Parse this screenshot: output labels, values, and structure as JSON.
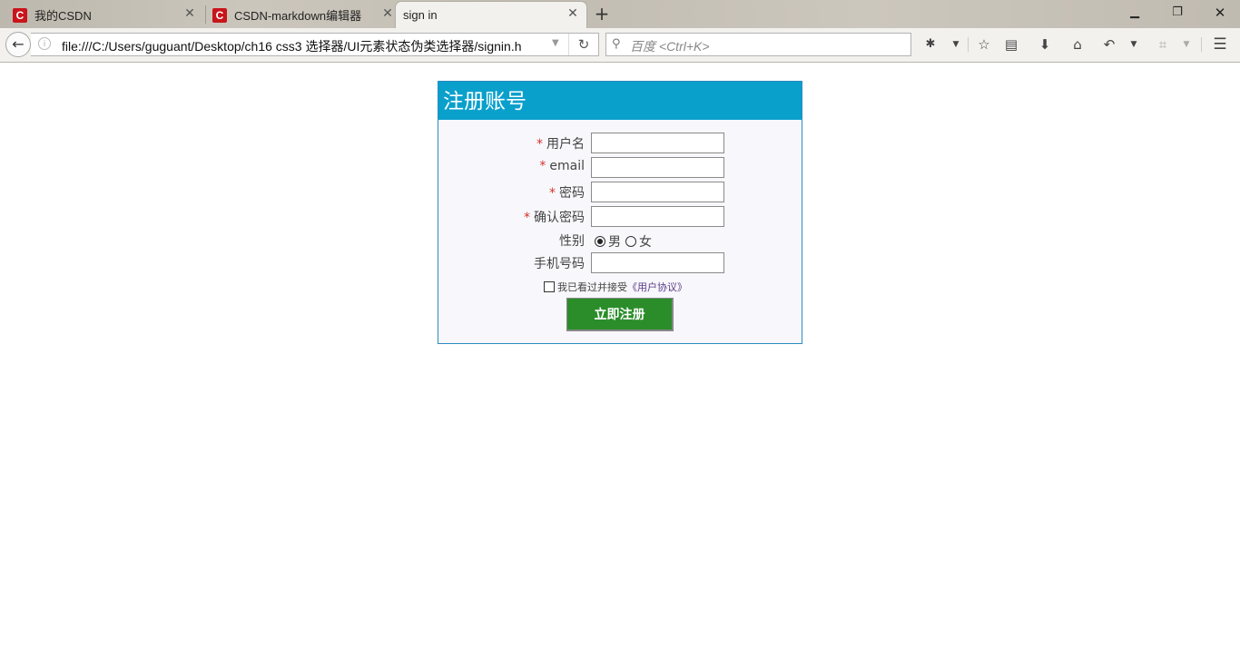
{
  "browser": {
    "tabs": [
      {
        "title": "我的CSDN",
        "favicon": "C",
        "active": false
      },
      {
        "title": "CSDN-markdown编辑器",
        "favicon": "C",
        "active": false
      },
      {
        "title": "sign in",
        "favicon": "",
        "active": true
      }
    ],
    "url": "file:///C:/Users/guguant/Desktop/ch16 css3 选择器/UI元素状态伪类选择器/signin.h",
    "search_placeholder": "百度 <Ctrl+K>",
    "accent_color": "#0aa0cc"
  },
  "form": {
    "title": "注册账号",
    "required_mark": "*",
    "fields": [
      {
        "label": "用户名",
        "required": true,
        "value": ""
      },
      {
        "label": "email",
        "required": true,
        "value": ""
      },
      {
        "label": "密码",
        "required": true,
        "value": ""
      },
      {
        "label": "确认密码",
        "required": true,
        "value": ""
      }
    ],
    "gender": {
      "label": "性别",
      "options": [
        "男",
        "女"
      ],
      "selected": "男"
    },
    "phone": {
      "label": "手机号码",
      "value": ""
    },
    "agreement": {
      "prefix": "我已看过并接受",
      "link": "《用户协议》",
      "checked": false
    },
    "submit_label": "立即注册",
    "header_color": "#0aa0cc",
    "button_color": "#2a8d2a"
  }
}
